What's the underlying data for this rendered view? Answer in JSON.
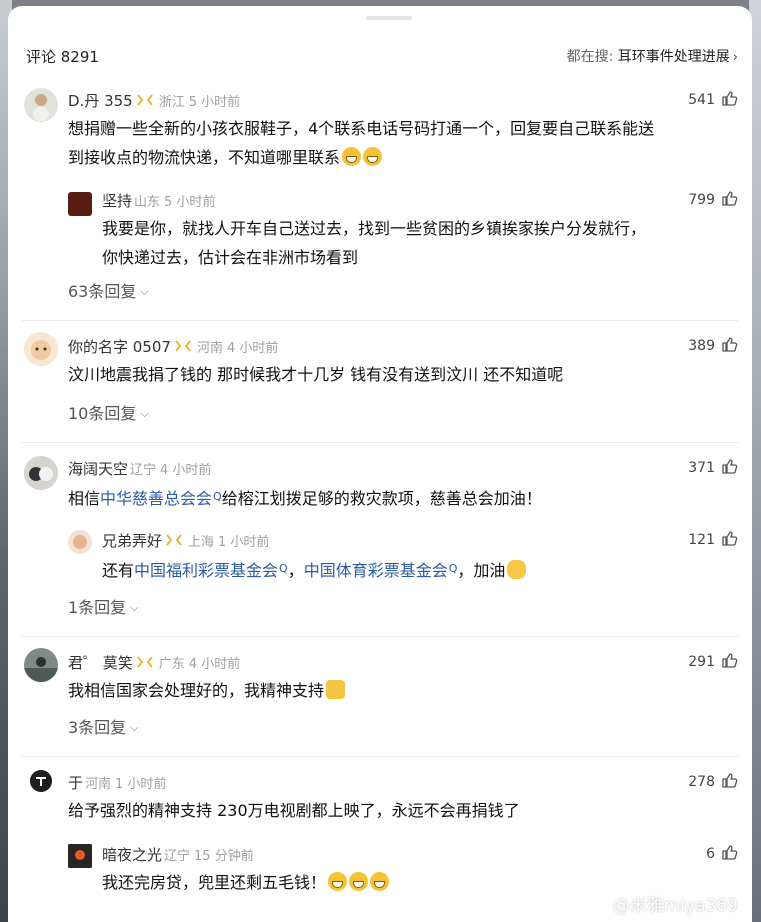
{
  "header": {
    "comment_count": "评论 8291",
    "search_prefix": "都在搜:",
    "search_term": "耳环事件处理进展"
  },
  "comments": [
    {
      "name": "D.丹 355",
      "region": "浙江",
      "time": "5 小时前",
      "likes": "541",
      "text_lines": [
        "想捐赠一些全新的小孩衣服鞋子，4个联系电话号码打通一个，回复要自己联系能送",
        "到接收点的物流快递，不知道哪里联系"
      ],
      "reply": {
        "name": "坚持",
        "region": "山东",
        "time": "5 小时前",
        "likes": "799",
        "text_lines": [
          "我要是你，就找人开车自己送过去，找到一些贫困的乡镇挨家挨户分发就行，",
          "你快递过去，估计会在非洲市场看到"
        ]
      },
      "more": "63条回复"
    },
    {
      "name": "你的名字 0507",
      "region": "河南",
      "time": "4 小时前",
      "likes": "389",
      "text_lines": [
        "汶川地震我捐了钱的 那时候我才十几岁 钱有没有送到汶川 还不知道呢"
      ],
      "more": "10条回复"
    },
    {
      "name": "海阔天空",
      "region": "辽宁",
      "time": "4 小时前",
      "likes": "371",
      "text_a": "相信",
      "text_link": "中华慈善总会会",
      "text_b": "给榕江划拨足够的救灾款项，慈善总会加油！",
      "reply": {
        "name": "兄弟弄好",
        "region": "上海",
        "time": "1 小时前",
        "likes": "121",
        "text_a": "还有",
        "link1": "中国福利彩票基金会",
        "sep": "，",
        "link2": "中国体育彩票基金会",
        "text_b": "，加油"
      },
      "more": "1条回复"
    },
    {
      "name": "君゜ 莫笑",
      "region": "广东",
      "time": "4 小时前",
      "likes": "291",
      "text_lines": [
        "我相信国家会处理好的，我精神支持"
      ],
      "more": "3条回复"
    },
    {
      "name": "于",
      "region": "河南",
      "time": "1 小时前",
      "likes": "278",
      "text_lines": [
        "给予强烈的精神支持  230万电视剧都上映了，永远不会再捐钱了"
      ],
      "reply": {
        "name": "暗夜之光",
        "region": "辽宁",
        "time": "15 分钟前",
        "likes": "6",
        "text_lines": [
          "我还完房贷，兜里还剩五毛钱！"
        ]
      }
    }
  ],
  "watermark": "@米雅miya369",
  "colors": {
    "link": "#2b5aa8",
    "muted": "#a0a0a0",
    "badge": "#e7b63a"
  }
}
